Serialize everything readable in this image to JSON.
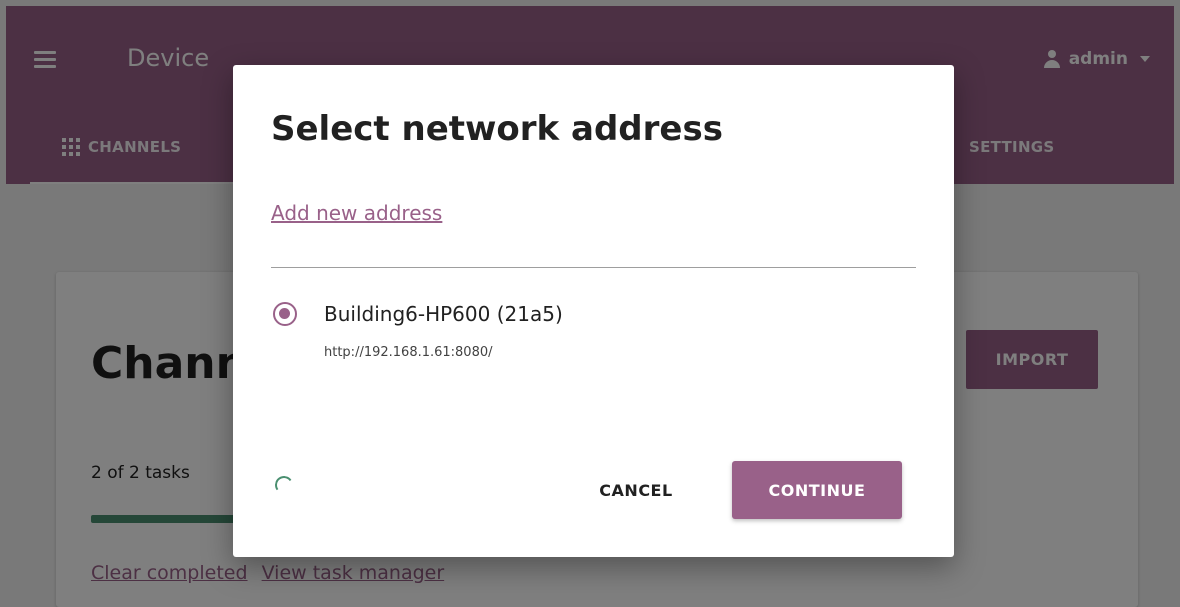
{
  "appbar": {
    "title": "Device",
    "user": "admin",
    "tabs": [
      {
        "label": "CHANNELS"
      },
      {
        "label": "SETTINGS"
      }
    ]
  },
  "card": {
    "title": "Chann",
    "import_label": "IMPORT",
    "tasks_text": "2 of 2 tasks",
    "progress": 1.0,
    "links": {
      "clear": "Clear completed",
      "view": "View task manager"
    }
  },
  "modal": {
    "title": "Select network address",
    "add_link": "Add new address",
    "addresses": [
      {
        "name": "Building6-HP600 (21a5)",
        "url": "http://192.168.1.61:8080/",
        "selected": true
      }
    ],
    "cancel_label": "CANCEL",
    "continue_label": "CONTINUE"
  },
  "colors": {
    "primary": "#996189",
    "success": "#4a8f70"
  }
}
